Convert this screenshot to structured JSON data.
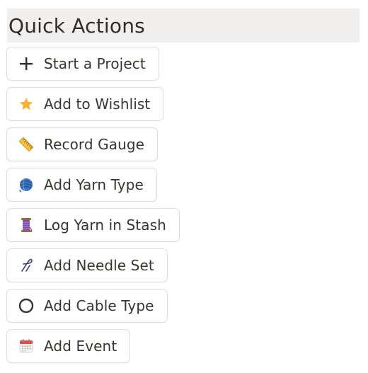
{
  "header": {
    "title": "Quick Actions"
  },
  "actions": [
    {
      "label": "Start a Project",
      "icon": "plus-icon"
    },
    {
      "label": "Add to Wishlist",
      "icon": "star-icon",
      "color": "#f2b233"
    },
    {
      "label": "Record Gauge",
      "icon": "ruler-icon",
      "color": "#f6c242"
    },
    {
      "label": "Add Yarn Type",
      "icon": "yarn-ball-icon",
      "color": "#3b78c4"
    },
    {
      "label": "Log Yarn in Stash",
      "icon": "thread-spool-icon",
      "color": "#7a4bb0"
    },
    {
      "label": "Add Needle Set",
      "icon": "knitting-needle-icon"
    },
    {
      "label": "Add Cable Type",
      "icon": "circle-outline-icon"
    },
    {
      "label": "Add Event",
      "icon": "calendar-icon",
      "color": "#e04a4a"
    }
  ]
}
